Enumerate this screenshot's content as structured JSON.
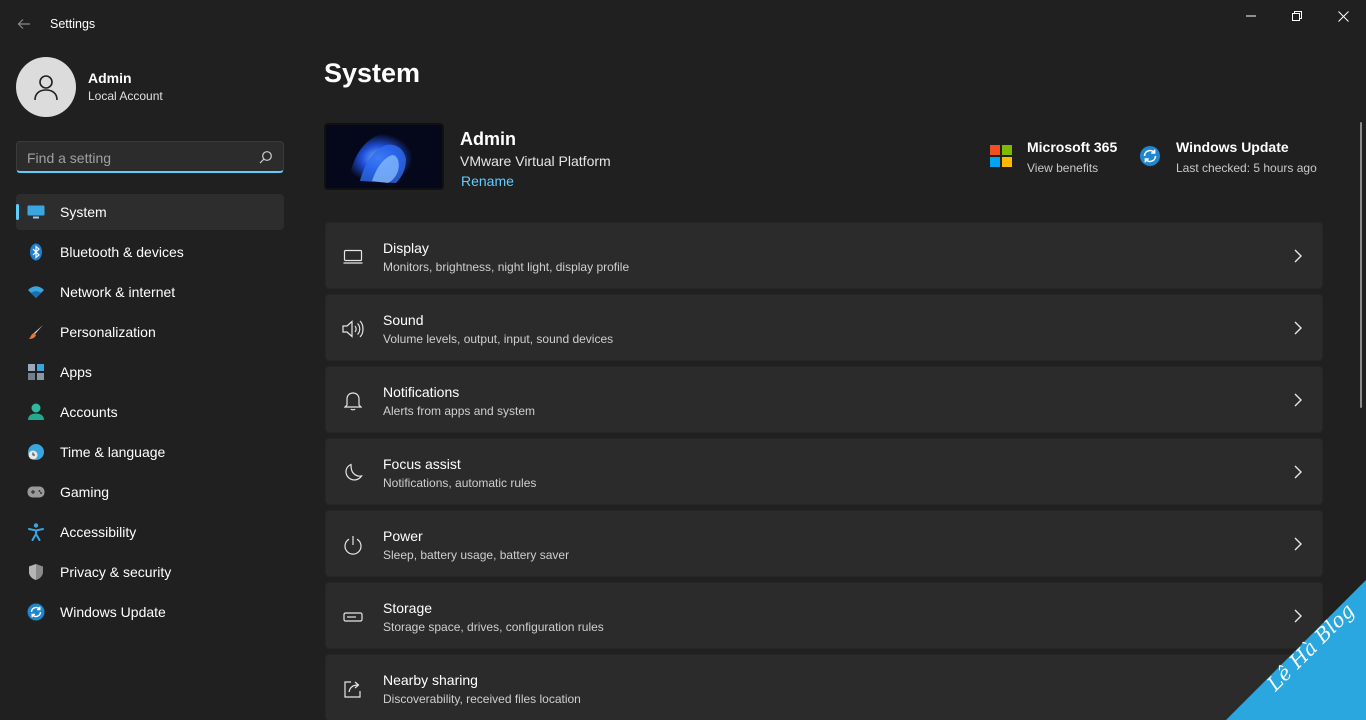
{
  "window": {
    "title": "Settings"
  },
  "profile": {
    "name": "Admin",
    "account_type": "Local Account"
  },
  "search": {
    "placeholder": "Find a setting"
  },
  "sidebar": {
    "items": [
      {
        "label": "System",
        "icon": "system-display-icon",
        "active": true
      },
      {
        "label": "Bluetooth & devices",
        "icon": "bluetooth-icon"
      },
      {
        "label": "Network & internet",
        "icon": "wifi-icon"
      },
      {
        "label": "Personalization",
        "icon": "brush-icon"
      },
      {
        "label": "Apps",
        "icon": "apps-icon"
      },
      {
        "label": "Accounts",
        "icon": "accounts-icon"
      },
      {
        "label": "Time & language",
        "icon": "time-language-icon"
      },
      {
        "label": "Gaming",
        "icon": "gamepad-icon"
      },
      {
        "label": "Accessibility",
        "icon": "accessibility-icon"
      },
      {
        "label": "Privacy & security",
        "icon": "shield-icon"
      },
      {
        "label": "Windows Update",
        "icon": "windows-update-icon"
      }
    ]
  },
  "main": {
    "title": "System",
    "device": {
      "name": "Admin",
      "model": "VMware Virtual Platform",
      "rename_label": "Rename"
    },
    "quick_links": [
      {
        "title": "Microsoft 365",
        "subtitle": "View benefits",
        "icon": "microsoft-logo-icon"
      },
      {
        "title": "Windows Update",
        "subtitle": "Last checked: 5 hours ago",
        "icon": "windows-update-icon"
      }
    ],
    "cards": [
      {
        "title": "Display",
        "subtitle": "Monitors, brightness, night light, display profile",
        "icon": "display-icon"
      },
      {
        "title": "Sound",
        "subtitle": "Volume levels, output, input, sound devices",
        "icon": "speaker-icon"
      },
      {
        "title": "Notifications",
        "subtitle": "Alerts from apps and system",
        "icon": "bell-icon"
      },
      {
        "title": "Focus assist",
        "subtitle": "Notifications, automatic rules",
        "icon": "moon-icon"
      },
      {
        "title": "Power",
        "subtitle": "Sleep, battery usage, battery saver",
        "icon": "power-icon"
      },
      {
        "title": "Storage",
        "subtitle": "Storage space, drives, configuration rules",
        "icon": "storage-icon"
      },
      {
        "title": "Nearby sharing",
        "subtitle": "Discoverability, received files location",
        "icon": "share-icon"
      }
    ]
  },
  "watermark": {
    "text": "Lê Hà Blog"
  },
  "colors": {
    "background": "#202020",
    "card": "#2b2b2b",
    "accent": "#60cdff"
  }
}
